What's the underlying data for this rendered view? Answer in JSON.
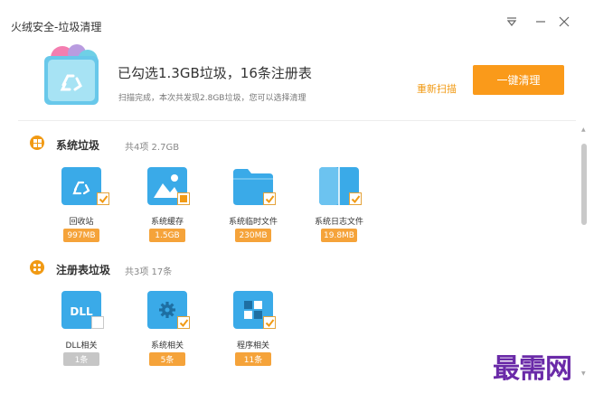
{
  "window": {
    "title": "火绒安全-垃圾清理",
    "controls": [
      "menu-icon",
      "minimize-icon",
      "close-icon"
    ]
  },
  "header": {
    "icon": "recycle-icon",
    "summary": "已勾选1.3GB垃圾，16条注册表",
    "subtext": "扫描完成，本次共发现2.8GB垃圾，您可以选择清理",
    "rescan_label": "重新扫描",
    "clean_label": "一键清理"
  },
  "colors": {
    "accent": "#f19a14",
    "button": "#fa9a1a",
    "folder_blue": "#3aaae8",
    "watermark": "#6a2aa8"
  },
  "sections": [
    {
      "title": "系统垃圾",
      "stats": "共4项 2.7GB",
      "icon": "windows-icon",
      "items": [
        {
          "label": "回收站",
          "size": "997MB",
          "checked": true,
          "icon": "recycle-bin-icon"
        },
        {
          "label": "系统缓存",
          "size": "1.5GB",
          "checked": "partial",
          "icon": "image-cache-icon"
        },
        {
          "label": "系统临时文件",
          "size": "230MB",
          "checked": true,
          "icon": "folder-icon"
        },
        {
          "label": "系统日志文件",
          "size": "19.8MB",
          "checked": true,
          "icon": "log-file-icon"
        }
      ]
    },
    {
      "title": "注册表垃圾",
      "stats": "共3项 17条",
      "icon": "registry-icon",
      "items": [
        {
          "label": "DLL相关",
          "size": "1条",
          "checked": false,
          "icon": "dll-file-icon",
          "icon_text": "DLL"
        },
        {
          "label": "系统相关",
          "size": "5条",
          "checked": true,
          "icon": "gear-file-icon"
        },
        {
          "label": "程序相关",
          "size": "11条",
          "checked": true,
          "icon": "app-grid-icon"
        }
      ]
    }
  ],
  "watermark": "最需网"
}
